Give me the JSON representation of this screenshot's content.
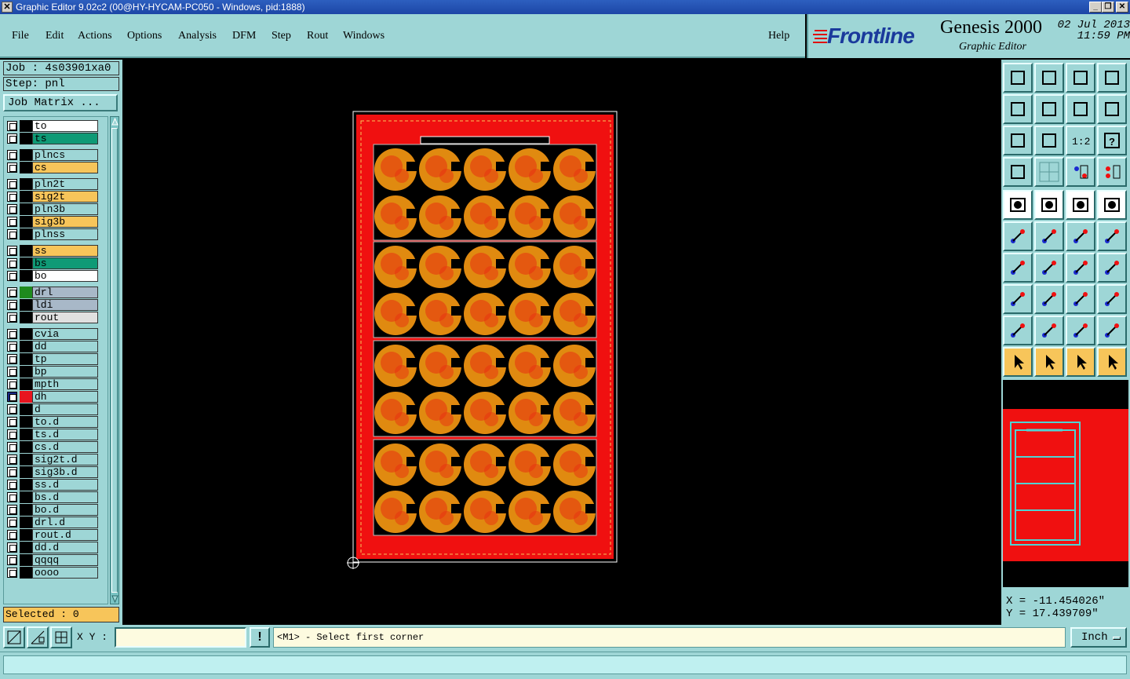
{
  "window": {
    "title": "Graphic Editor 9.02c2 (00@HY-HYCAM-PC050 - Windows, pid:1888)",
    "controls": [
      "_",
      "❐",
      "✕"
    ]
  },
  "menu": [
    "File",
    "Edit",
    "Actions",
    "Options",
    "Analysis",
    "DFM",
    "Step",
    "Rout",
    "Windows"
  ],
  "help_label": "Help",
  "logo": {
    "brand": "Frontline",
    "product": "Genesis 2000",
    "subtitle": "Graphic Editor",
    "date": "02 Jul 2013",
    "time": "11:59 PM"
  },
  "job": {
    "job_label": "Job : 4s03901xa0",
    "step_label": "Step: pnl",
    "matrix_button": "Job Matrix ..."
  },
  "layers": [
    {
      "name": "to",
      "color": "#ffffff",
      "swatch": "#000000"
    },
    {
      "name": "ts",
      "color": "#0f9a76",
      "swatch": "#000000"
    },
    {
      "name": "plncs",
      "color": "#9ed6d6",
      "swatch": "#000000"
    },
    {
      "name": "cs",
      "color": "#f7c55a",
      "swatch": "#000000"
    },
    {
      "name": "pln2t",
      "color": "#9ed6d6",
      "swatch": "#000000"
    },
    {
      "name": "sig2t",
      "color": "#f7c55a",
      "swatch": "#000000"
    },
    {
      "name": "pln3b",
      "color": "#9ed6d6",
      "swatch": "#000000"
    },
    {
      "name": "sig3b",
      "color": "#f7c55a",
      "swatch": "#000000"
    },
    {
      "name": "plnss",
      "color": "#9ed6d6",
      "swatch": "#000000"
    },
    {
      "name": "ss",
      "color": "#f7c55a",
      "swatch": "#000000"
    },
    {
      "name": "bs",
      "color": "#0f9a76",
      "swatch": "#000000"
    },
    {
      "name": "bo",
      "color": "#ffffff",
      "swatch": "#000000"
    },
    {
      "name": "drl",
      "color": "#a8b8c8",
      "swatch": "#1e8a1e"
    },
    {
      "name": "ldi",
      "color": "#a8b8c8",
      "swatch": "#000000"
    },
    {
      "name": "rout",
      "color": "#e0e0e0",
      "swatch": "#000000"
    },
    {
      "name": "cvia",
      "color": "#9ed6d6",
      "swatch": "#000000"
    },
    {
      "name": "dd",
      "color": "#9ed6d6",
      "swatch": "#000000"
    },
    {
      "name": "tp",
      "color": "#9ed6d6",
      "swatch": "#000000"
    },
    {
      "name": "bp",
      "color": "#9ed6d6",
      "swatch": "#000000"
    },
    {
      "name": "mpth",
      "color": "#9ed6d6",
      "swatch": "#000000"
    },
    {
      "name": "dh",
      "color": "#9ed6d6",
      "swatch": "#e8141e"
    },
    {
      "name": "d",
      "color": "#9ed6d6",
      "swatch": "#000000"
    },
    {
      "name": "to.d",
      "color": "#9ed6d6",
      "swatch": "#000000"
    },
    {
      "name": "ts.d",
      "color": "#9ed6d6",
      "swatch": "#000000"
    },
    {
      "name": "cs.d",
      "color": "#9ed6d6",
      "swatch": "#000000"
    },
    {
      "name": "sig2t.d",
      "color": "#9ed6d6",
      "swatch": "#000000"
    },
    {
      "name": "sig3b.d",
      "color": "#9ed6d6",
      "swatch": "#000000"
    },
    {
      "name": "ss.d",
      "color": "#9ed6d6",
      "swatch": "#000000"
    },
    {
      "name": "bs.d",
      "color": "#9ed6d6",
      "swatch": "#000000"
    },
    {
      "name": "bo.d",
      "color": "#9ed6d6",
      "swatch": "#000000"
    },
    {
      "name": "drl.d",
      "color": "#9ed6d6",
      "swatch": "#000000"
    },
    {
      "name": "rout.d",
      "color": "#9ed6d6",
      "swatch": "#000000"
    },
    {
      "name": "dd.d",
      "color": "#9ed6d6",
      "swatch": "#000000"
    },
    {
      "name": "qqqq",
      "color": "#9ed6d6",
      "swatch": "#000000"
    },
    {
      "name": "oooo",
      "color": "#9ed6d6",
      "swatch": "#000000"
    }
  ],
  "selected_label": "Selected : 0",
  "toolbar_icons": [
    "open-job-icon",
    "save-icon",
    "home-icon",
    "window-split-icon",
    "prev-step-icon",
    "next-step-icon",
    "swap-icon",
    "s-route-icon",
    "zoom-fit-icon",
    "zoom-home-icon",
    "ratio-1-2-icon",
    "help-query-icon",
    "tools-icon",
    "grid-icon",
    "netlist-red-icon",
    "netlist-compare-icon",
    "film-icon",
    "edit-shape-icon",
    "ruler-icon",
    "pad-select-icon",
    "connect-icon",
    "cross-icon",
    "add-line-icon",
    "add-red-dot-icon",
    "draw-angle-icon",
    "draw-line-icon",
    "arc-icon",
    "feature-flip-icon",
    "copy-feature-icon",
    "minus-icon",
    "measure-icon",
    "shape-group-icon",
    "triangle-red-icon",
    "triangle-a-icon",
    "triangle-a2-icon",
    "triangle-a3-icon",
    "pointer-icon",
    "select-box-icon",
    "select-region-icon",
    "route-tool-icon"
  ],
  "coords": {
    "x_label": "X = -11.454026\"",
    "y_label": "Y = 17.439709\""
  },
  "bottom": {
    "xy_label": "X Y :",
    "xy_value": "",
    "excl_label": "!",
    "prompt": "<M1> - Select first corner",
    "units": "Inch"
  },
  "colors": {
    "panel": "#9ed6d6",
    "board_red": "#f01010",
    "copper_orange": "#e08a10",
    "outline": "#ffffff"
  }
}
